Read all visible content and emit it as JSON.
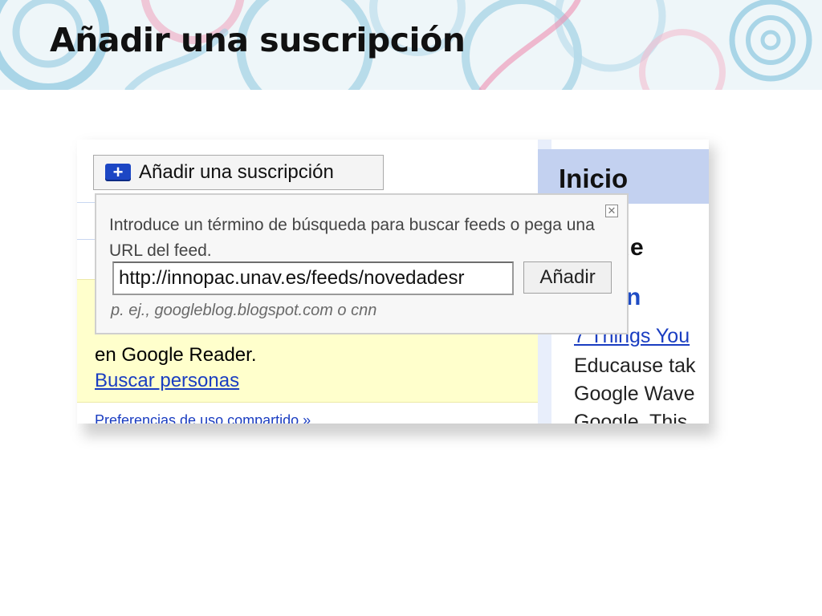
{
  "slide": {
    "title": "Añadir una suscripción"
  },
  "reader": {
    "add_button_label": "Añadir una suscripción",
    "popup": {
      "instructions": "Introduce un término de búsqueda para buscar feeds o pega una URL del feed.",
      "url_value": "http://innopac.unav.es/feeds/novedadesr",
      "submit_label": "Añadir",
      "example": "p. ej., googleblog.blogspot.com o cnn"
    },
    "left_text": "en Google Reader.",
    "left_link": "Buscar personas",
    "left_bottom_link": "Preferencias de uso compartido »",
    "right": {
      "header": "Inicio",
      "novedades": "edade",
      "blog": "rarian",
      "items": [
        "7 Things You",
        "Educause tak",
        "Google Wave",
        "Google. This"
      ]
    }
  },
  "colors": {
    "link": "#1a3dc1",
    "header_bg": "#c3d1f0",
    "notice_bg": "#ffffcc",
    "plus_icon": "#1c46c4"
  },
  "icons": {
    "add": "plus-icon",
    "close": "close-icon"
  }
}
